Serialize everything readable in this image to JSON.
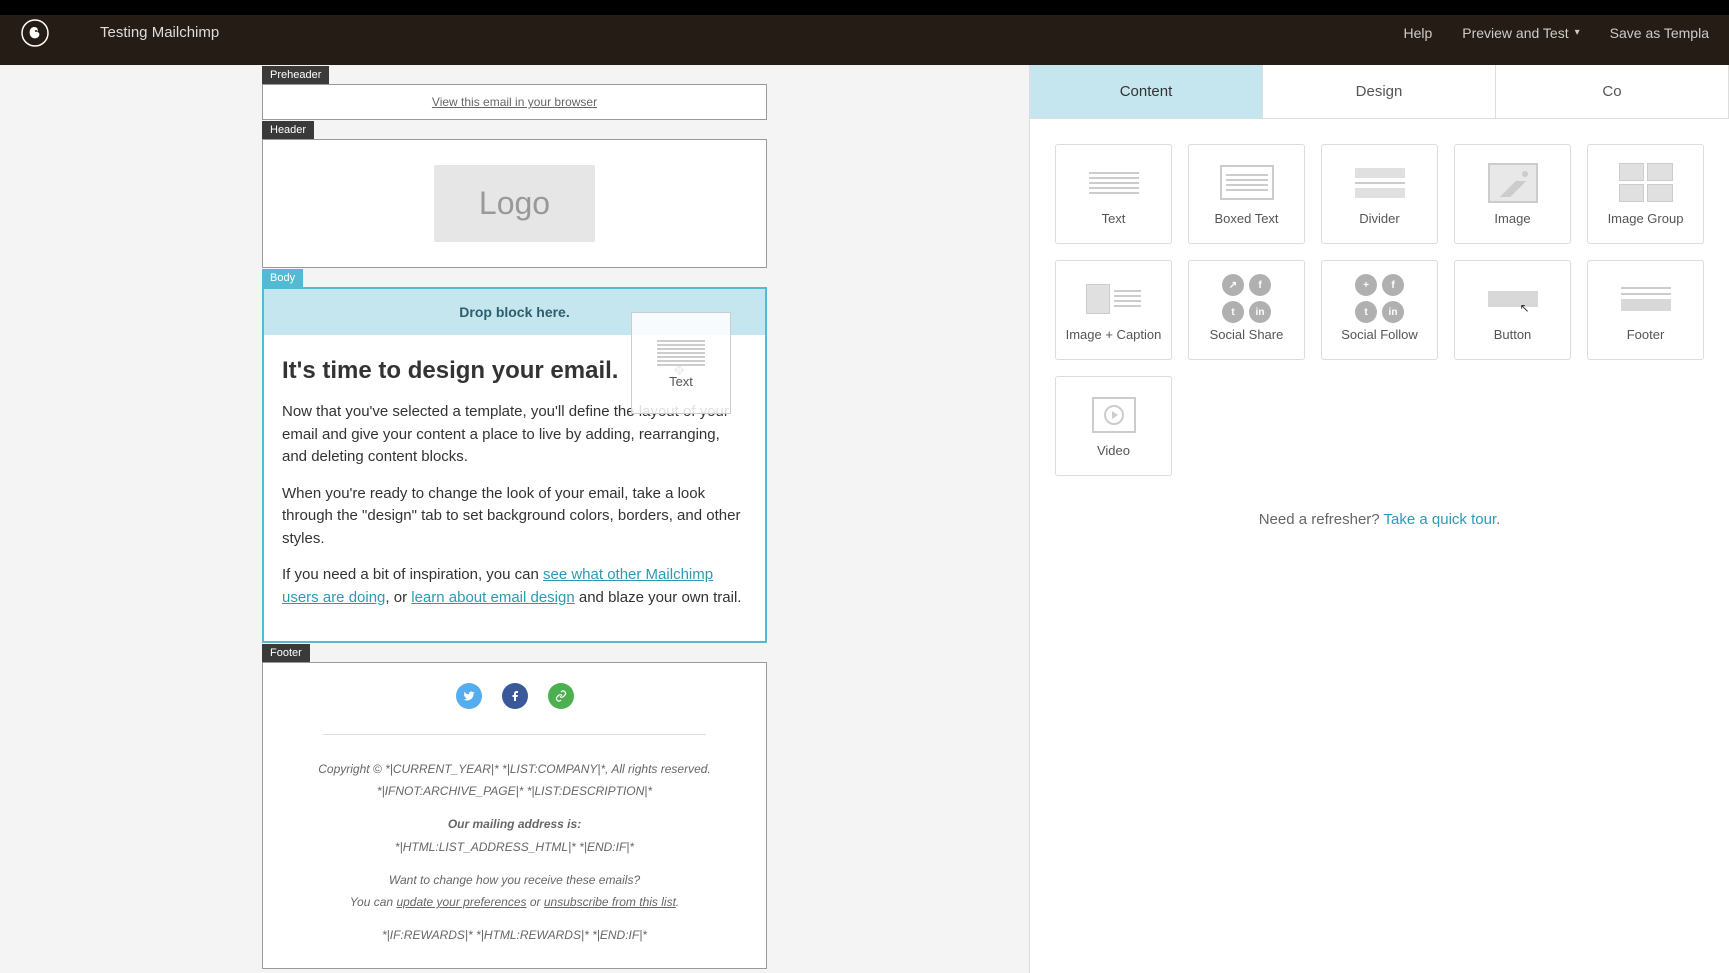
{
  "topbar": {
    "campaign_name": "Testing Mailchimp",
    "help": "Help",
    "preview": "Preview and Test",
    "save_template": "Save as Templa"
  },
  "canvas": {
    "labels": {
      "preheader": "Preheader",
      "header": "Header",
      "body": "Body",
      "footer": "Footer"
    },
    "preheader_link": "View this email in your browser",
    "logo_text": "Logo",
    "drop_text": "Drop block here.",
    "body": {
      "heading": "It's time to design your email.",
      "p1": "Now that you've selected a template, you'll define the layout of your email and give your content a place to live by adding, rearranging, and deleting content blocks.",
      "p2a": "When you're ready to change the look of your email, take a look through the \"design\" tab to set background colors, borders, and other styles.",
      "p3a": "If you need a bit of inspiration, you can ",
      "link1": "see what other Mailchimp users are doing",
      "p3b": ", or ",
      "link2": "learn about email design",
      "p3c": " and blaze your own trail."
    },
    "footer": {
      "copyright": "Copyright © *|CURRENT_YEAR|* *|LIST:COMPANY|*, All rights reserved.",
      "archive": "*|IFNOT:ARCHIVE_PAGE|* *|LIST:DESCRIPTION|*",
      "address_label": "Our mailing address is:",
      "address": "*|HTML:LIST_ADDRESS_HTML|* *|END:IF|*",
      "change_q": "Want to change how you receive these emails?",
      "you_can": "You can ",
      "update_pref": "update your preferences",
      "or": " or ",
      "unsubscribe": "unsubscribe from this list",
      "period": ".",
      "rewards": "*|IF:REWARDS|* *|HTML:REWARDS|* *|END:IF|*"
    }
  },
  "ghost": {
    "label": "Text"
  },
  "panel": {
    "tabs": {
      "content": "Content",
      "design": "Design",
      "comments": "Co"
    },
    "blocks": [
      {
        "label": "Text",
        "key": "text"
      },
      {
        "label": "Boxed Text",
        "key": "boxed-text"
      },
      {
        "label": "Divider",
        "key": "divider"
      },
      {
        "label": "Image",
        "key": "image"
      },
      {
        "label": "Image Group",
        "key": "image-group"
      },
      {
        "label": "Image + Caption",
        "key": "image-caption"
      },
      {
        "label": "Social Share",
        "key": "social-share"
      },
      {
        "label": "Social Follow",
        "key": "social-follow"
      },
      {
        "label": "Button",
        "key": "button"
      },
      {
        "label": "Footer",
        "key": "footer"
      },
      {
        "label": "Video",
        "key": "video"
      }
    ],
    "refresher_text": "Need a refresher? ",
    "refresher_link": "Take a quick tour",
    "refresher_end": "."
  },
  "colors": {
    "twitter": "#55acee",
    "facebook": "#3b5998",
    "link": "#4caf50"
  }
}
